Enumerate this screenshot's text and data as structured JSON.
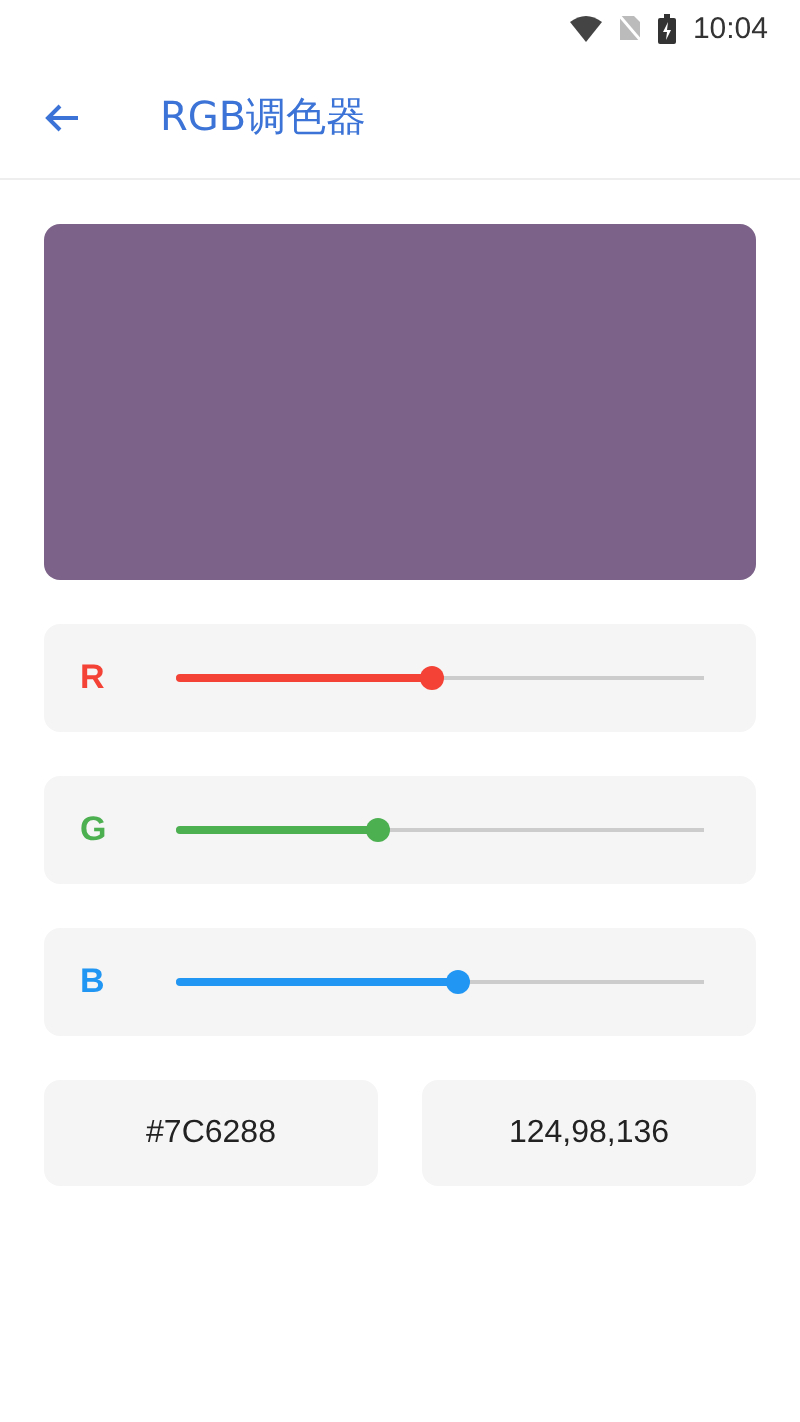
{
  "status_bar": {
    "time": "10:04"
  },
  "app_bar": {
    "title": "RGB调色器"
  },
  "preview": {
    "color": "#7c6288"
  },
  "channels": [
    {
      "label": "R",
      "color": "#f44336",
      "level": 0.486
    },
    {
      "label": "G",
      "color": "#4caf50",
      "level": 0.384
    },
    {
      "label": "B",
      "color": "#2196f3",
      "level": 0.533
    }
  ],
  "outputs": [
    "#7C6288",
    "124,98,136"
  ]
}
